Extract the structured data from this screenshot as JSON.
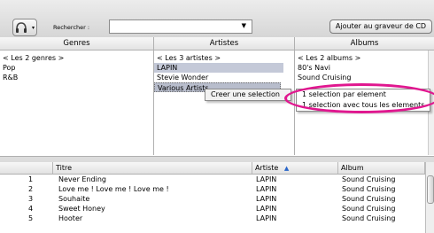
{
  "toolbar": {
    "search_label": "Rechercher :",
    "search_value": "",
    "burn_label": "Ajouter au graveur de CD"
  },
  "columns": {
    "genres": {
      "title": "Genres",
      "items": [
        "< Les 2 genres >",
        "Pop",
        "R&B"
      ]
    },
    "artistes": {
      "title": "Artistes",
      "items": [
        "< Les 3 artistes >",
        "LAPIN",
        "Stevie Wonder",
        "Various Artists"
      ]
    },
    "albums": {
      "title": "Albums",
      "items": [
        "< Les 2 albums >",
        "80's Navi",
        "Sound Cruising"
      ]
    }
  },
  "context_menu": {
    "item": "Creer une selection"
  },
  "submenu": {
    "items": [
      "1 selection par element",
      "1 selection avec tous les elements"
    ]
  },
  "annotation_color": "#e0178f",
  "tracks": {
    "headers": {
      "num": "",
      "title": "Titre",
      "artist": "Artiste",
      "album": "Album"
    },
    "rows": [
      {
        "num": "1",
        "title": "Never Ending",
        "artist": "LAPIN",
        "album": "Sound Cruising"
      },
      {
        "num": "2",
        "title": "Love me ! Love me ! Love me !",
        "artist": "LAPIN",
        "album": "Sound Cruising"
      },
      {
        "num": "3",
        "title": "Souhaite",
        "artist": "LAPIN",
        "album": "Sound Cruising"
      },
      {
        "num": "4",
        "title": "Sweet Honey",
        "artist": "LAPIN",
        "album": "Sound Cruising"
      },
      {
        "num": "5",
        "title": "Hooter",
        "artist": "LAPIN",
        "album": "Sound Cruising"
      }
    ]
  }
}
